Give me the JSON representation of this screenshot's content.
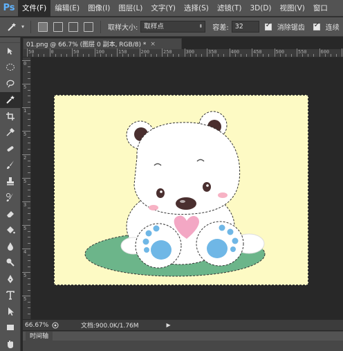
{
  "app": {
    "logo": "Ps"
  },
  "menu": [
    "文件(F)",
    "编辑(E)",
    "图像(I)",
    "图层(L)",
    "文字(Y)",
    "选择(S)",
    "滤镜(T)",
    "3D(D)",
    "视图(V)",
    "窗口"
  ],
  "options": {
    "sample_size_label": "取样大小:",
    "sample_size_value": "取样点",
    "tolerance_label": "容差:",
    "tolerance_value": "32",
    "antialias_label": "消除锯齿",
    "contiguous_label": "连续"
  },
  "document": {
    "tab_title": "01.png @ 66.7% (图层 0 副本, RGB/8) *",
    "close_glyph": "×",
    "canvas_color": "#fdfac4"
  },
  "rulers": {
    "top": [
      "50",
      "0",
      "50",
      "100",
      "150",
      "200",
      "250",
      "300",
      "350",
      "400",
      "450",
      "500",
      "550",
      "600",
      "650"
    ],
    "left": [
      "0",
      "5",
      "1",
      "5",
      "2",
      "5",
      "3",
      "5",
      "4",
      "5",
      "5"
    ]
  },
  "status": {
    "zoom": "66.67%",
    "doc_info": "文档:900.0K/1.76M",
    "arrow_glyph": "▶"
  },
  "timeline": {
    "tab_label": "时间轴"
  },
  "tools": [
    "move-tool-icon",
    "marquee-tool-icon",
    "lasso-tool-icon",
    "magic-wand-tool-icon",
    "crop-tool-icon",
    "eyedropper-tool-icon",
    "healing-brush-tool-icon",
    "brush-tool-icon",
    "clone-stamp-tool-icon",
    "history-brush-tool-icon",
    "eraser-tool-icon",
    "paint-bucket-tool-icon",
    "blur-tool-icon",
    "dodge-tool-icon",
    "pen-tool-icon",
    "type-tool-icon",
    "path-selection-tool-icon",
    "rectangle-tool-icon",
    "hand-tool-icon"
  ],
  "colors": {
    "bear_white": "#ffffff",
    "paw_blue": "#6fb7e6",
    "heart_pink": "#f3a7c4",
    "grass_green": "#6cb58a",
    "nose_brown": "#4a2f2f",
    "cheek_pink": "#f7b2c4"
  }
}
